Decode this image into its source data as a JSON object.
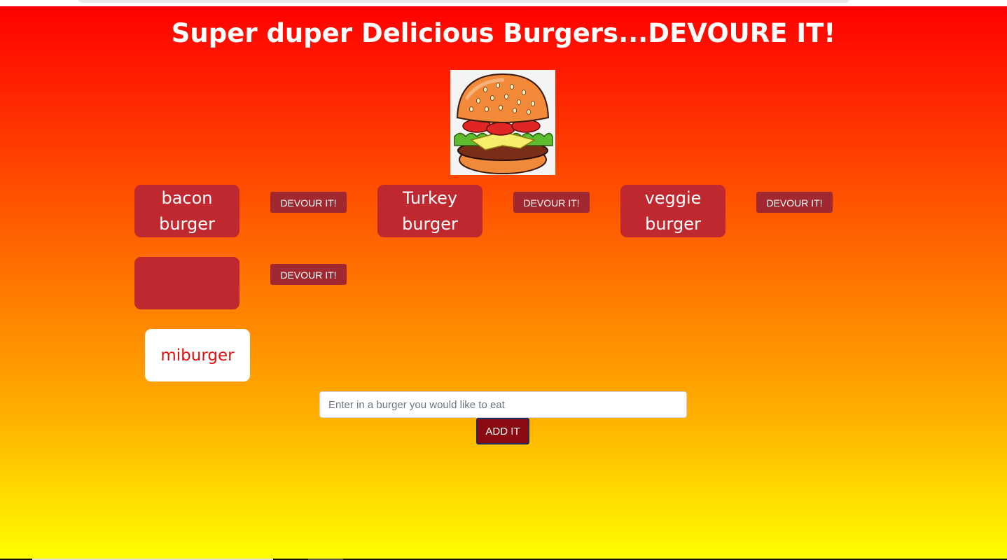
{
  "header": {
    "title": "Super duper Delicious Burgers...DEVOURE IT!"
  },
  "logo": {
    "icon": "burger-icon"
  },
  "burgers": [
    {
      "name": "bacon burger",
      "action_label": "DEVOUR IT!"
    },
    {
      "name": "Turkey burger",
      "action_label": "DEVOUR IT!"
    },
    {
      "name": "veggie burger",
      "action_label": "DEVOUR IT!"
    },
    {
      "name": "",
      "action_label": "DEVOUR IT!"
    }
  ],
  "devoured": [
    {
      "name": "miburger"
    }
  ],
  "form": {
    "placeholder": "Enter in a burger you would like to eat",
    "value": "",
    "submit_label": "ADD IT"
  },
  "colors": {
    "card": "#c0282f",
    "button": "#a12830",
    "submit": "#8a0c12",
    "gradient_top": "#ff0000",
    "gradient_bottom": "#ffff00"
  }
}
